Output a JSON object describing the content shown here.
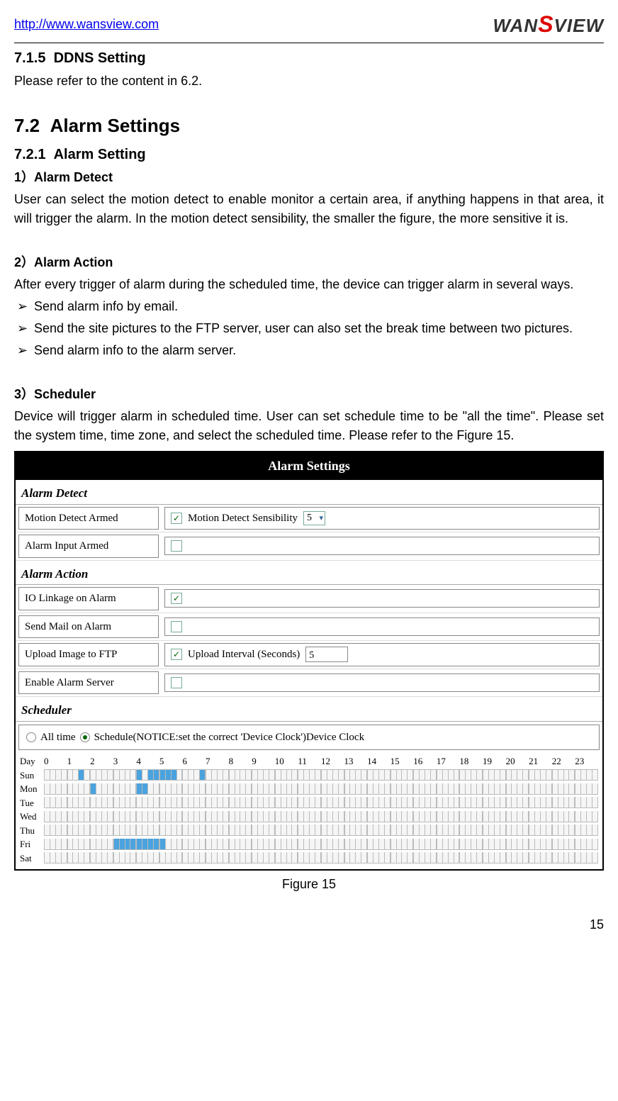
{
  "header": {
    "url": "http://www.wansview.com",
    "logo_text": "WANSVIEW"
  },
  "s715": {
    "num": "7.1.5",
    "title": "DDNS Setting",
    "body": "Please refer to the content in 6.2."
  },
  "s72": {
    "num": "7.2",
    "title": "Alarm Settings"
  },
  "s721": {
    "num": "7.2.1",
    "title": "Alarm Setting"
  },
  "item1": {
    "heading": "1）Alarm Detect",
    "body": "User can select the motion detect to enable monitor a certain area, if anything happens in that area, it will trigger the alarm. In the motion detect sensibility, the smaller the figure, the more sensitive it is."
  },
  "item2": {
    "heading": "2）Alarm Action",
    "body": "After every trigger of alarm during the scheduled time, the device can trigger alarm in several ways.",
    "bullets": [
      "Send alarm info by email.",
      "Send the site pictures to the FTP server, user can also set the break time between two pictures.",
      "Send alarm info to the alarm server."
    ]
  },
  "item3": {
    "heading": "3）Scheduler",
    "body": "Device will trigger alarm in scheduled time. User can set schedule time to be \"all the time\". Please set the system time, time zone, and select the scheduled time. Please refer to the Figure 15."
  },
  "figure": {
    "title": "Alarm Settings",
    "caption": "Figure 15",
    "detect": {
      "header": "Alarm Detect",
      "motion_label": "Motion Detect Armed",
      "motion_checked": true,
      "sensibility_label": "Motion Detect Sensibility",
      "sensibility_value": "5",
      "input_label": "Alarm Input Armed",
      "input_checked": false
    },
    "action": {
      "header": "Alarm Action",
      "io_label": "IO Linkage on Alarm",
      "io_checked": true,
      "mail_label": "Send Mail on Alarm",
      "mail_checked": false,
      "ftp_label": "Upload Image to FTP",
      "ftp_checked": true,
      "interval_label": "Upload Interval (Seconds)",
      "interval_value": "5",
      "server_label": "Enable Alarm Server",
      "server_checked": false
    },
    "scheduler": {
      "header": "Scheduler",
      "all_time_label": "All time",
      "schedule_label": "Schedule(NOTICE:set the correct 'Device Clock')Device Clock",
      "selected": "schedule",
      "day_header": "Day",
      "hours": [
        "0",
        "1",
        "2",
        "3",
        "4",
        "5",
        "6",
        "7",
        "8",
        "9",
        "10",
        "11",
        "12",
        "13",
        "14",
        "15",
        "16",
        "17",
        "18",
        "19",
        "20",
        "21",
        "22",
        "23"
      ],
      "days": [
        "Sun",
        "Mon",
        "Tue",
        "Wed",
        "Thu",
        "Fri",
        "Sat"
      ],
      "selections": {
        "Sun": [
          6,
          16,
          18,
          19,
          20,
          21,
          22,
          27
        ],
        "Mon": [
          8,
          16,
          17
        ],
        "Tue": [],
        "Wed": [],
        "Thu": [],
        "Fri": [
          12,
          13,
          14,
          15,
          16,
          17,
          18,
          19,
          20
        ],
        "Sat": []
      }
    }
  },
  "page_number": "15"
}
